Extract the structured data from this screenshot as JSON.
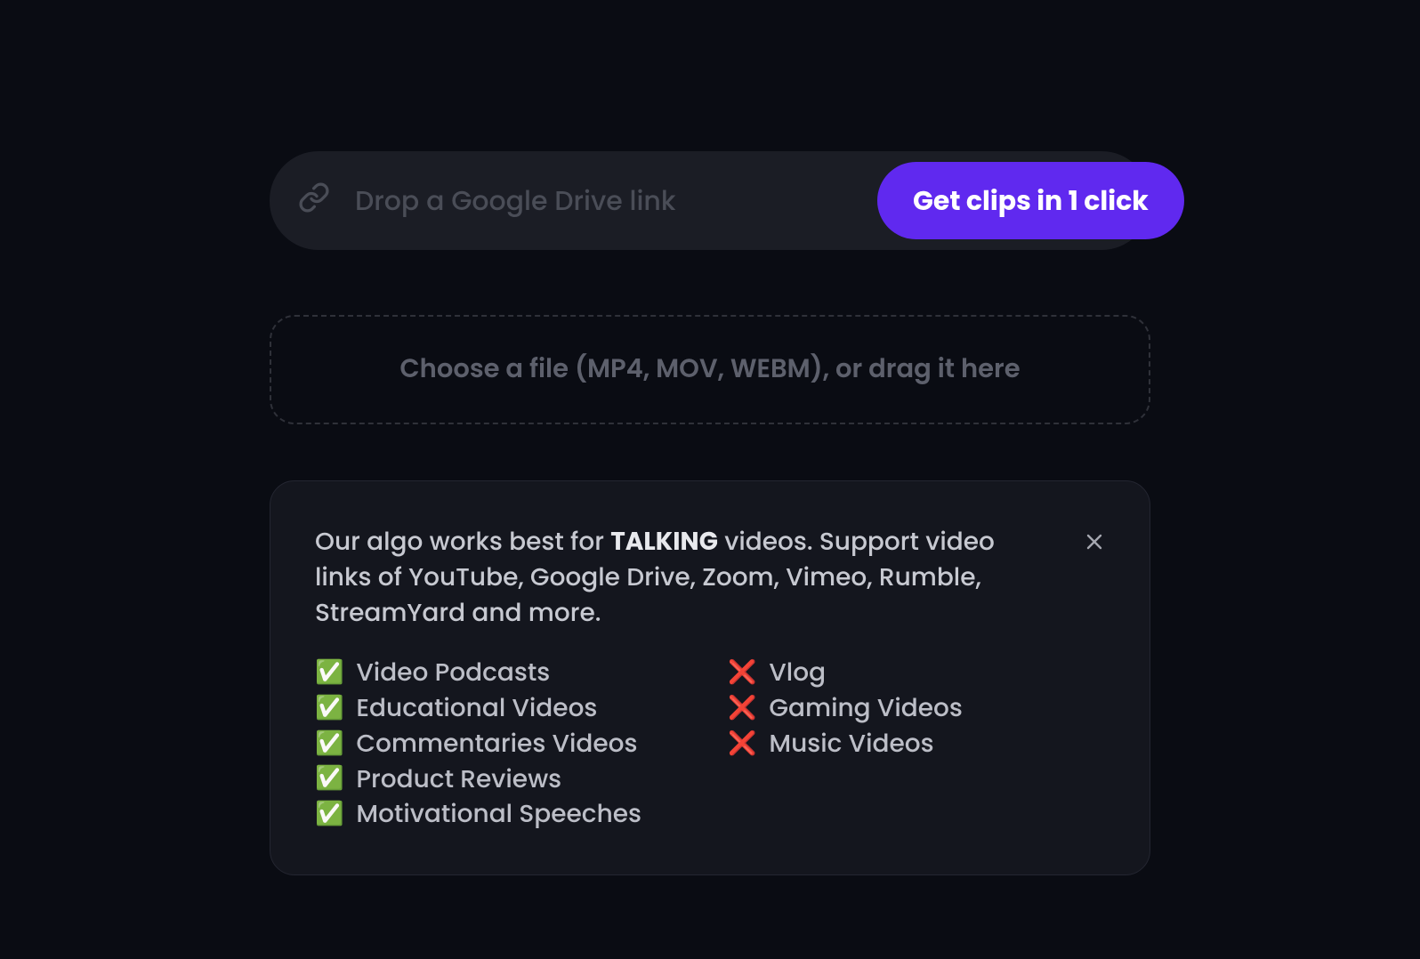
{
  "input": {
    "placeholder": "Drop a Google Drive link",
    "value": ""
  },
  "cta": {
    "label": "Get clips in 1 click"
  },
  "dropzone": {
    "text": "Choose a file (MP4, MOV, WEBM), or drag it here"
  },
  "info": {
    "description_prefix": "Our algo works best for ",
    "description_highlight": "TALKING",
    "description_suffix": " videos. Support video links of YouTube, Google Drive, Zoom, Vimeo, Rumble, StreamYard and more.",
    "supported": [
      "Video Podcasts",
      "Educational Videos",
      "Commentaries Videos",
      "Product Reviews",
      "Motivational Speeches"
    ],
    "unsupported": [
      "Vlog",
      "Gaming Videos",
      "Music Videos"
    ],
    "supported_icon": "✅",
    "unsupported_icon": "❌"
  }
}
